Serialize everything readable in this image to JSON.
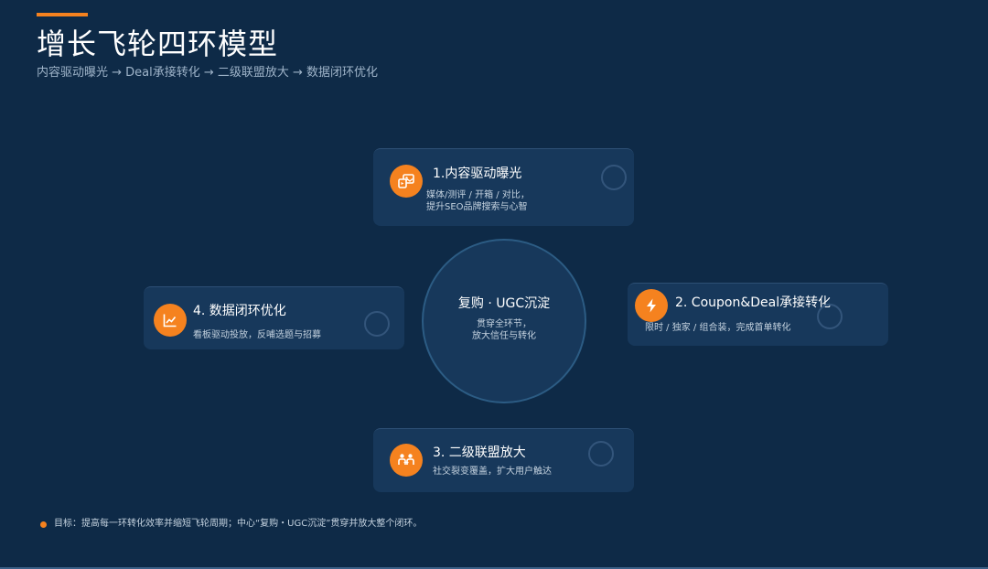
{
  "header": {
    "title": "增长飞轮四环模型",
    "subtitle": "内容驱动曝光 → Deal承接转化 → 二级联盟放大 → 数据闭环优化",
    "accent_color": "#f5821f"
  },
  "hub": {
    "title": "复购 · UGC沉淀",
    "description": "贯穿全环节，\n放大信任与转化"
  },
  "cards": [
    {
      "title": "1.内容驱动曝光",
      "description": "媒体/测评 / 开箱 / 对比，\n提升SEO品牌搜索与心智",
      "icon": "media-gallery-icon"
    },
    {
      "title": "2. Coupon&Deal承接转化",
      "description": "限时 / 独家 / 组合装，完成首单转化",
      "icon": "lightning-icon"
    },
    {
      "title": "3. 二级联盟放大",
      "description": "社交裂变覆盖，扩大用户触达",
      "icon": "people-network-icon"
    },
    {
      "title": "4. 数据闭环优化",
      "description": "看板驱动投放，反哺选题与招募",
      "icon": "line-chart-icon"
    }
  ],
  "footer": {
    "text": "目标：提高每一环转化效率并缩短飞轮周期；中心“复购・UGC沉淀”贯穿并放大整个闭环。"
  },
  "colors": {
    "background": "#0e2a47",
    "card": "#17385b",
    "accent": "#f5821f"
  }
}
